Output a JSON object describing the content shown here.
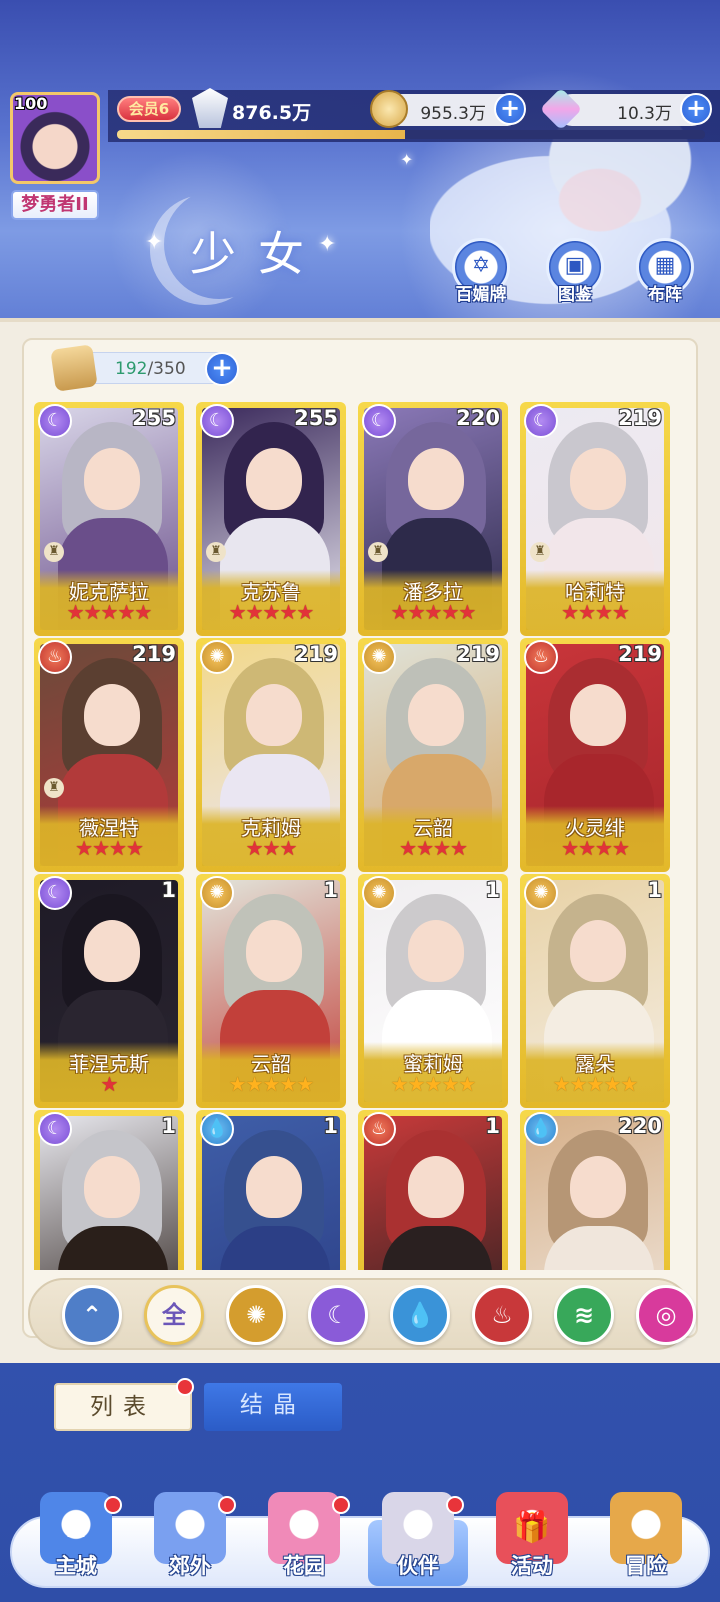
{
  "player": {
    "level": "100",
    "rank_title": "梦勇者II",
    "vip": "会员6",
    "power": "876.5万",
    "exp_progress": 0.49
  },
  "currencies": [
    {
      "name": "coins",
      "value": "955.3万",
      "icon": "gold-coin-icon"
    },
    {
      "name": "gems",
      "value": "10.3万",
      "icon": "diamond-icon"
    }
  ],
  "page_title": "少女",
  "top_actions": [
    {
      "label": "百媚牌",
      "icon": "card-deck-icon"
    },
    {
      "label": "图鉴",
      "icon": "book-icon"
    },
    {
      "label": "布阵",
      "icon": "grid-formation-icon"
    }
  ],
  "capacity": {
    "current": "192",
    "max": "/350"
  },
  "cards": [
    {
      "name": "妮克萨拉",
      "level": "255",
      "element": "moon",
      "stars": 5,
      "star_color": "red",
      "palette": [
        "#d9d6e8",
        "#6a4e8a"
      ]
    },
    {
      "name": "克苏鲁",
      "level": "255",
      "element": "moon",
      "stars": 5,
      "star_color": "red",
      "palette": [
        "#3b2a5c",
        "#e8e6ef"
      ]
    },
    {
      "name": "潘多拉",
      "level": "220",
      "element": "moon",
      "stars": 5,
      "star_color": "red",
      "palette": [
        "#8b79b8",
        "#2d2a4a"
      ]
    },
    {
      "name": "哈莉特",
      "level": "219",
      "element": "moon",
      "stars": 4,
      "star_color": "red",
      "palette": [
        "#eceaf2",
        "#f2e6ea"
      ]
    },
    {
      "name": "薇涅特",
      "level": "219",
      "element": "fire",
      "stars": 4,
      "star_color": "red",
      "palette": [
        "#6b4a3a",
        "#b23a3a"
      ]
    },
    {
      "name": "克莉姆",
      "level": "219",
      "element": "sun",
      "stars": 3,
      "star_color": "red",
      "palette": [
        "#f2d88a",
        "#eae6f2"
      ]
    },
    {
      "name": "云韶",
      "level": "219",
      "element": "sun",
      "stars": 4,
      "star_color": "red",
      "palette": [
        "#dfe2d8",
        "#d8a86a"
      ]
    },
    {
      "name": "火灵绯",
      "level": "219",
      "element": "fire",
      "stars": 4,
      "star_color": "red",
      "palette": [
        "#c8353a",
        "#a8262c"
      ]
    },
    {
      "name": "菲涅克斯",
      "level": "1",
      "element": "moon",
      "stars": 1,
      "star_color": "red",
      "palette": [
        "#1e1a26",
        "#2a2530"
      ]
    },
    {
      "name": "云韶",
      "level": "1",
      "element": "sun",
      "stars": 5,
      "star_color": "gold",
      "palette": [
        "#e2e4da",
        "#c2403a"
      ]
    },
    {
      "name": "蜜莉姆",
      "level": "1",
      "element": "sun",
      "stars": 5,
      "star_color": "gold",
      "palette": [
        "#f0eef0",
        "#ffffff"
      ]
    },
    {
      "name": "露朵",
      "level": "1",
      "element": "sun",
      "stars": 5,
      "star_color": "gold",
      "palette": [
        "#e8d2a6",
        "#f4ede2"
      ]
    },
    {
      "name": "",
      "level": "1",
      "element": "moon",
      "stars": 0,
      "star_color": "red",
      "palette": [
        "#e8e8ee",
        "#2a1f1a"
      ]
    },
    {
      "name": "",
      "level": "1",
      "element": "water",
      "stars": 0,
      "star_color": "red",
      "palette": [
        "#3f5ea8",
        "#2c3f86"
      ]
    },
    {
      "name": "",
      "level": "1",
      "element": "fire",
      "stars": 0,
      "star_color": "red",
      "palette": [
        "#c83a3a",
        "#2a2020"
      ]
    },
    {
      "name": "",
      "level": "220",
      "element": "water",
      "stars": 0,
      "star_color": "red",
      "palette": [
        "#d6b08a",
        "#f0e6dc"
      ]
    }
  ],
  "filters": [
    {
      "label": "",
      "key": "class",
      "icon": "chevron-up-icon",
      "color": "#4f7ec8"
    },
    {
      "label": "全",
      "key": "all",
      "icon": "all-icon",
      "color": "#fbf6ea",
      "active": true
    },
    {
      "label": "",
      "key": "sun",
      "icon": "sun-icon",
      "color": "#d49d2e"
    },
    {
      "label": "",
      "key": "moon",
      "icon": "moon-icon",
      "color": "#8a5bd8"
    },
    {
      "label": "",
      "key": "water",
      "icon": "water-drop-icon",
      "color": "#3a93d8"
    },
    {
      "label": "",
      "key": "fire",
      "icon": "fire-icon",
      "color": "#c8383a"
    },
    {
      "label": "",
      "key": "wind",
      "icon": "wind-icon",
      "color": "#38a85a"
    },
    {
      "label": "",
      "key": "spirit",
      "icon": "swirl-icon",
      "color": "#d83a9c"
    }
  ],
  "tabs": {
    "list": "列表",
    "crystal": "结晶"
  },
  "bottom_nav": [
    {
      "label": "主城",
      "icon": "castle-icon",
      "badge": true
    },
    {
      "label": "郊外",
      "icon": "hexagram-icon",
      "badge": true
    },
    {
      "label": "花园",
      "icon": "heart-icon",
      "badge": true
    },
    {
      "label": "伙伴",
      "icon": "partner-avatar-icon",
      "badge": true,
      "active": true
    },
    {
      "label": "活动",
      "icon": "gift-box-icon",
      "badge": false
    },
    {
      "label": "冒险",
      "icon": "compass-icon",
      "badge": false
    }
  ],
  "colors": {
    "card_gold": "#e3b82a",
    "accent_blue": "#2f63d6",
    "badge_red": "#e8343a"
  }
}
